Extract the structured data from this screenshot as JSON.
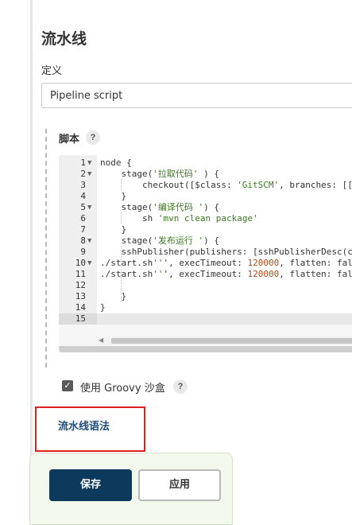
{
  "section": {
    "title": "流水线"
  },
  "definition": {
    "label": "定义",
    "selected": "Pipeline script"
  },
  "script": {
    "label": "脚本",
    "help": "?"
  },
  "editor": {
    "lines": [
      {
        "no": "1",
        "fold": "▼",
        "code": "node {"
      },
      {
        "no": "2",
        "fold": "▼",
        "code": "    stage('拉取代码' ) {"
      },
      {
        "no": "3",
        "fold": "",
        "code": "        checkout([$class: 'GitSCM', branches: [["
      },
      {
        "no": "4",
        "fold": "",
        "code": "    }"
      },
      {
        "no": "5",
        "fold": "▼",
        "code": "    stage('编译代码 ') {"
      },
      {
        "no": "6",
        "fold": "",
        "code": "        sh 'mvn clean package'"
      },
      {
        "no": "7",
        "fold": "",
        "code": "    }"
      },
      {
        "no": "8",
        "fold": "▼",
        "code": "    stage('发布运行 ') {"
      },
      {
        "no": "9",
        "fold": "",
        "code": "    sshPublisher(publishers: [sshPublisherDesc(c"
      },
      {
        "no": "10",
        "fold": "▼",
        "code": "./start.sh''', execTimeout: 120000, flatten: fal"
      },
      {
        "no": "11",
        "fold": "",
        "code": "./start.sh''', execTimeout: 120000, flatten: fal"
      },
      {
        "no": "12",
        "fold": "",
        "code": ""
      },
      {
        "no": "13",
        "fold": "",
        "code": "    }"
      },
      {
        "no": "14",
        "fold": "",
        "code": "}"
      },
      {
        "no": "15",
        "fold": "",
        "code": ""
      }
    ],
    "active_line": "15"
  },
  "sandbox": {
    "label": "使用 Groovy 沙盒",
    "checked": true,
    "help": "?"
  },
  "syntax_link": {
    "label": "流水线语法"
  },
  "buttons": {
    "save": "保存",
    "apply": "应用"
  },
  "colors": {
    "save_bg": "#0d3a5c",
    "link": "#1e4a7a",
    "highlight_border": "#e02020",
    "footer_bg": "#f3f8ec"
  }
}
